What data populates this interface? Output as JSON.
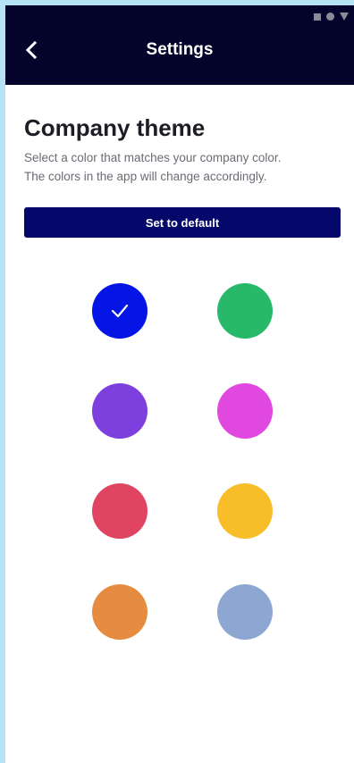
{
  "header": {
    "title": "Settings",
    "back_icon": "chevron-left-icon",
    "status_icons": [
      "square-icon",
      "circle-icon",
      "triangle-icon"
    ]
  },
  "theme": {
    "heading": "Company theme",
    "description_line1": "Select a color that matches your company color.",
    "description_line2": "The colors in the app will change accordingly.",
    "default_button": "Set to default"
  },
  "swatches": [
    {
      "name": "blue",
      "color": "#0515e6",
      "selected": true
    },
    {
      "name": "green",
      "color": "#27b86a",
      "selected": false
    },
    {
      "name": "purple",
      "color": "#7d40df",
      "selected": false
    },
    {
      "name": "magenta",
      "color": "#e048df",
      "selected": false
    },
    {
      "name": "red",
      "color": "#e14461",
      "selected": false
    },
    {
      "name": "yellow",
      "color": "#f8be2a",
      "selected": false
    },
    {
      "name": "orange",
      "color": "#e58c41",
      "selected": false
    },
    {
      "name": "light-blue",
      "color": "#8ea6d2",
      "selected": false
    }
  ]
}
